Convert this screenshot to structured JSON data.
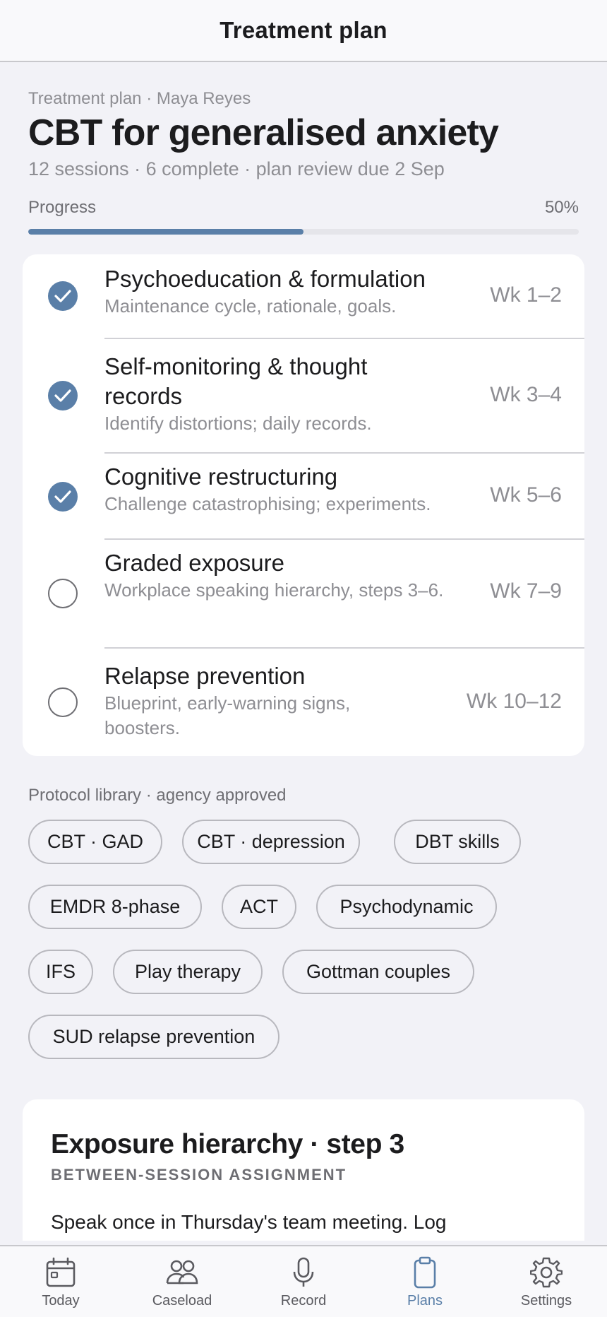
{
  "topbar": {
    "title": "Treatment plan"
  },
  "header": {
    "eyebrow": "Treatment plan · Maya Reyes",
    "title": "CBT for generalised anxiety",
    "meta": "12 sessions · 6 complete · plan review due 2 Sep"
  },
  "progress": {
    "label": "Progress",
    "value_text": "50%",
    "fraction": 0.5
  },
  "phases": [
    {
      "name": "Psychoeducation & formulation",
      "desc": "Maintenance cycle, rationale, goals.",
      "weeks": "Wk 1–2",
      "done": true
    },
    {
      "name": "Self-monitoring & thought records",
      "desc": "Identify distortions; daily records.",
      "weeks": "Wk 3–4",
      "done": true
    },
    {
      "name": "Cognitive restructuring",
      "desc": "Challenge catastrophising; experiments.",
      "weeks": "Wk 5–6",
      "done": true
    },
    {
      "name": "Graded exposure",
      "desc": "Workplace speaking hierarchy, steps 3–6.",
      "weeks": "Wk 7–9",
      "done": false
    },
    {
      "name": "Relapse prevention",
      "desc": "Blueprint, early-warning signs, boosters.",
      "weeks": "Wk 10–12",
      "done": false
    }
  ],
  "library": {
    "label": "Protocol library · agency approved",
    "chips": [
      "CBT · GAD",
      "CBT · depression",
      "DBT skills",
      "EMDR 8-phase",
      "ACT",
      "Psychodynamic",
      "IFS",
      "Play therapy",
      "Gottman couples",
      "SUD relapse prevention"
    ]
  },
  "assignment": {
    "title": "Exposure hierarchy · step 3",
    "subtitle": "BETWEEN-SESSION ASSIGNMENT",
    "body": "Speak once in Thursday's team meeting. Log"
  },
  "tabs": [
    {
      "label": "Today",
      "icon": "calendar-icon",
      "active": false
    },
    {
      "label": "Caseload",
      "icon": "people-icon",
      "active": false
    },
    {
      "label": "Record",
      "icon": "microphone-icon",
      "active": false
    },
    {
      "label": "Plans",
      "icon": "clipboard-icon",
      "active": true
    },
    {
      "label": "Settings",
      "icon": "gear-icon",
      "active": false
    }
  ],
  "colors": {
    "accent": "#5a7fa8",
    "muted": "#8e8e93",
    "background": "#f2f2f7"
  }
}
